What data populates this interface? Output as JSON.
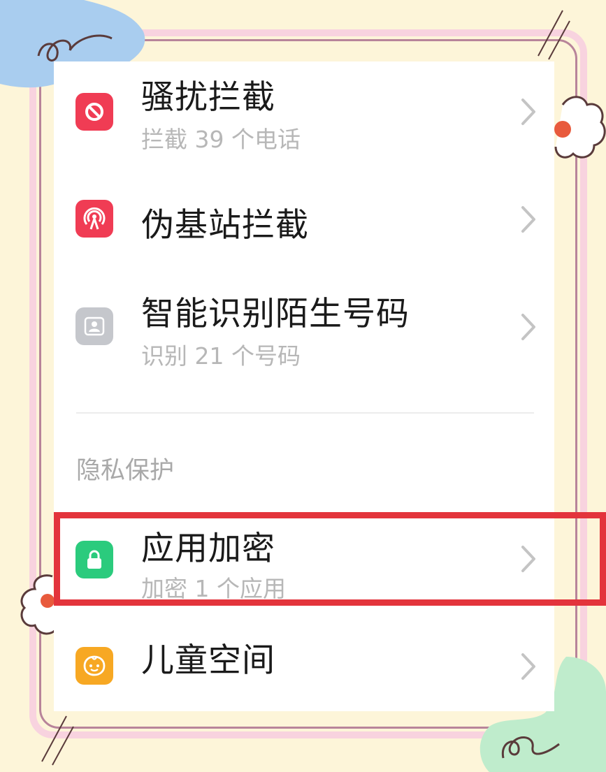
{
  "colors": {
    "background": "#fdf5d9",
    "frame_pink": "#f8d3df",
    "highlight_red": "#e3343c",
    "icon_red": "#f03c54",
    "icon_gray": "#c5c7cc",
    "icon_green": "#2bcb7d",
    "icon_orange": "#f7a823"
  },
  "items": [
    {
      "title": "骚扰拦截",
      "subtitle": "拦截 39 个电话",
      "icon": "block-icon"
    },
    {
      "title": "伪基站拦截",
      "subtitle": "",
      "icon": "signal-tower-icon"
    },
    {
      "title": "智能识别陌生号码",
      "subtitle": "识别 21 个号码",
      "icon": "contact-card-icon"
    },
    {
      "title": "应用加密",
      "subtitle": "加密 1 个应用",
      "icon": "lock-icon"
    },
    {
      "title": "儿童空间",
      "subtitle": "",
      "icon": "child-face-icon"
    }
  ],
  "section_privacy": "隐私保护"
}
